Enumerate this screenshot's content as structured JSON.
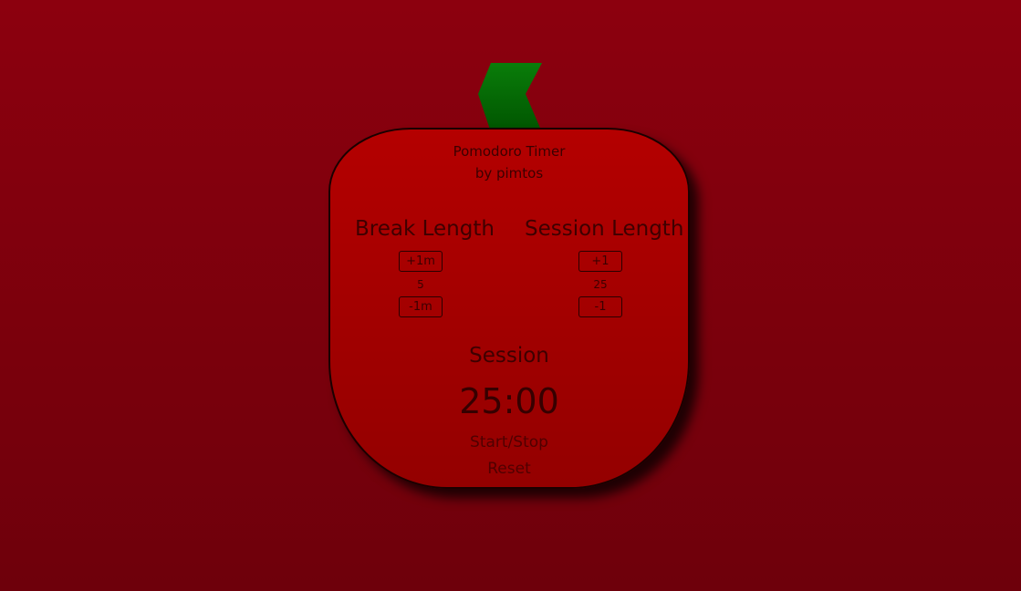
{
  "app": {
    "title": "Pomodoro Timer",
    "author": "by pimtos"
  },
  "break": {
    "label": "Break Length",
    "plus_label": "+1m",
    "value": "5",
    "minus_label": "-1m"
  },
  "session": {
    "label": "Session Length",
    "plus_label": "+1",
    "value": "25",
    "minus_label": "-1"
  },
  "timer": {
    "mode": "Session",
    "display": "25:00",
    "start_stop_label": "Start/Stop",
    "reset_label": "Reset"
  },
  "colors": {
    "background": "#8c000e",
    "tomato": "#b40000",
    "stem": "#0a7d0a"
  }
}
